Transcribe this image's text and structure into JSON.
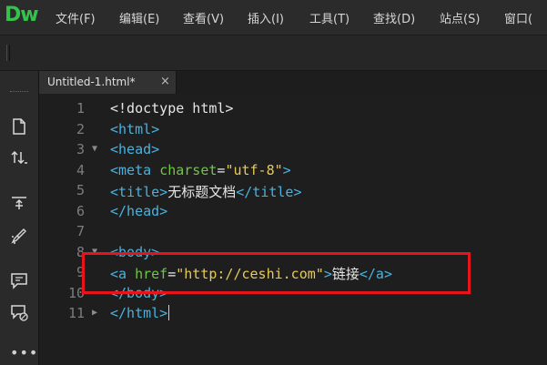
{
  "app": {
    "logo": "Dw"
  },
  "menu": [
    "文件(F)",
    "编辑(E)",
    "查看(V)",
    "插入(I)",
    "工具(T)",
    "查找(D)",
    "站点(S)",
    "窗口("
  ],
  "tab": {
    "label": "Untitled-1.html*",
    "close": "×"
  },
  "left_tools": [
    "file-icon",
    "sort-arrows-icon",
    "expand-icon",
    "brush-icon",
    "comment-icon",
    "comment-check-icon"
  ],
  "more_label": "•••",
  "colors": {
    "tag": "#4ab2de",
    "attr": "#72c447",
    "value": "#e7ca5a",
    "text": "#e6e6e6",
    "highlight": "#e8141c",
    "logo": "#34c24c"
  },
  "editor": {
    "lines": [
      {
        "n": "1",
        "fold": "",
        "tokens": [
          {
            "t": "plain",
            "v": "<!doctype html>"
          }
        ]
      },
      {
        "n": "2",
        "fold": "",
        "tokens": [
          {
            "t": "tag",
            "v": "<html>"
          }
        ]
      },
      {
        "n": "3",
        "fold": "▼",
        "tokens": [
          {
            "t": "tag",
            "v": "<head>"
          }
        ]
      },
      {
        "n": "4",
        "fold": "",
        "tokens": [
          {
            "t": "tag",
            "v": "<meta "
          },
          {
            "t": "attr",
            "v": "charset"
          },
          {
            "t": "plain",
            "v": "="
          },
          {
            "t": "val",
            "v": "\"utf-8\""
          },
          {
            "t": "tag",
            "v": ">"
          }
        ]
      },
      {
        "n": "5",
        "fold": "",
        "tokens": [
          {
            "t": "tag",
            "v": "<title>"
          },
          {
            "t": "plain",
            "v": "无标题文档"
          },
          {
            "t": "tag",
            "v": "</title>"
          }
        ]
      },
      {
        "n": "6",
        "fold": "",
        "tokens": [
          {
            "t": "tag",
            "v": "</head>"
          }
        ]
      },
      {
        "n": "7",
        "fold": "",
        "tokens": []
      },
      {
        "n": "8",
        "fold": "▼",
        "tokens": [
          {
            "t": "tag",
            "v": "<body>"
          }
        ]
      },
      {
        "n": "9",
        "fold": "",
        "tokens": [
          {
            "t": "tag",
            "v": "<a "
          },
          {
            "t": "attr",
            "v": "href"
          },
          {
            "t": "plain",
            "v": "="
          },
          {
            "t": "val",
            "v": "\"http://ceshi.com\""
          },
          {
            "t": "tag",
            "v": ">"
          },
          {
            "t": "plain",
            "v": "链接"
          },
          {
            "t": "tag",
            "v": "</a>"
          }
        ]
      },
      {
        "n": "10",
        "fold": "",
        "tokens": [
          {
            "t": "tag",
            "v": "</body>"
          }
        ]
      },
      {
        "n": "11",
        "fold": "▶",
        "tokens": [
          {
            "t": "tag",
            "v": "</html>"
          }
        ]
      }
    ]
  }
}
